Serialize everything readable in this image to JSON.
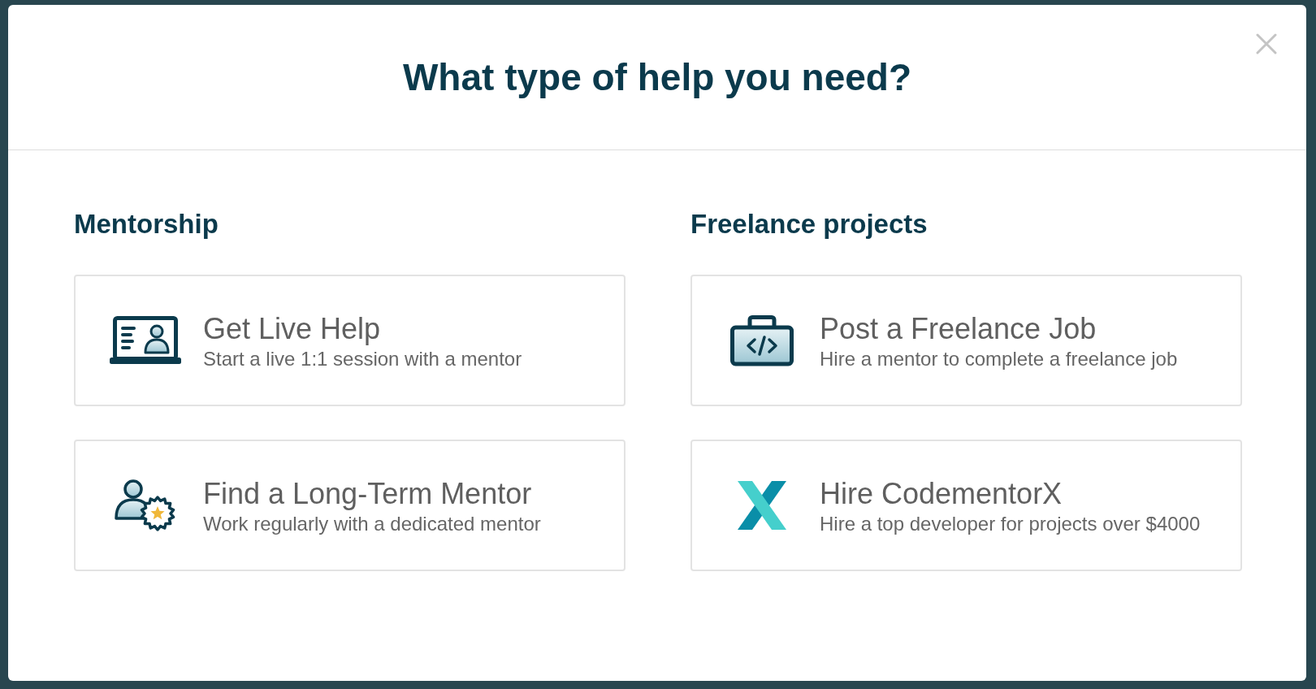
{
  "dialog": {
    "title": "What type of help you need?"
  },
  "sections": [
    {
      "heading": "Mentorship",
      "options": [
        {
          "kind": "live-help",
          "title": "Get Live Help",
          "description": "Start a live 1:1 session with a mentor"
        },
        {
          "kind": "long-term-mentor",
          "title": "Find a Long-Term Mentor",
          "description": "Work regularly with a dedicated mentor"
        }
      ]
    },
    {
      "heading": "Freelance projects",
      "options": [
        {
          "kind": "freelance-job",
          "title": "Post a Freelance Job",
          "description": "Hire a mentor to complete a freelance job"
        },
        {
          "kind": "codementorx",
          "title": "Hire CodementorX",
          "description": "Hire a top developer for projects over $4000"
        }
      ]
    }
  ]
}
